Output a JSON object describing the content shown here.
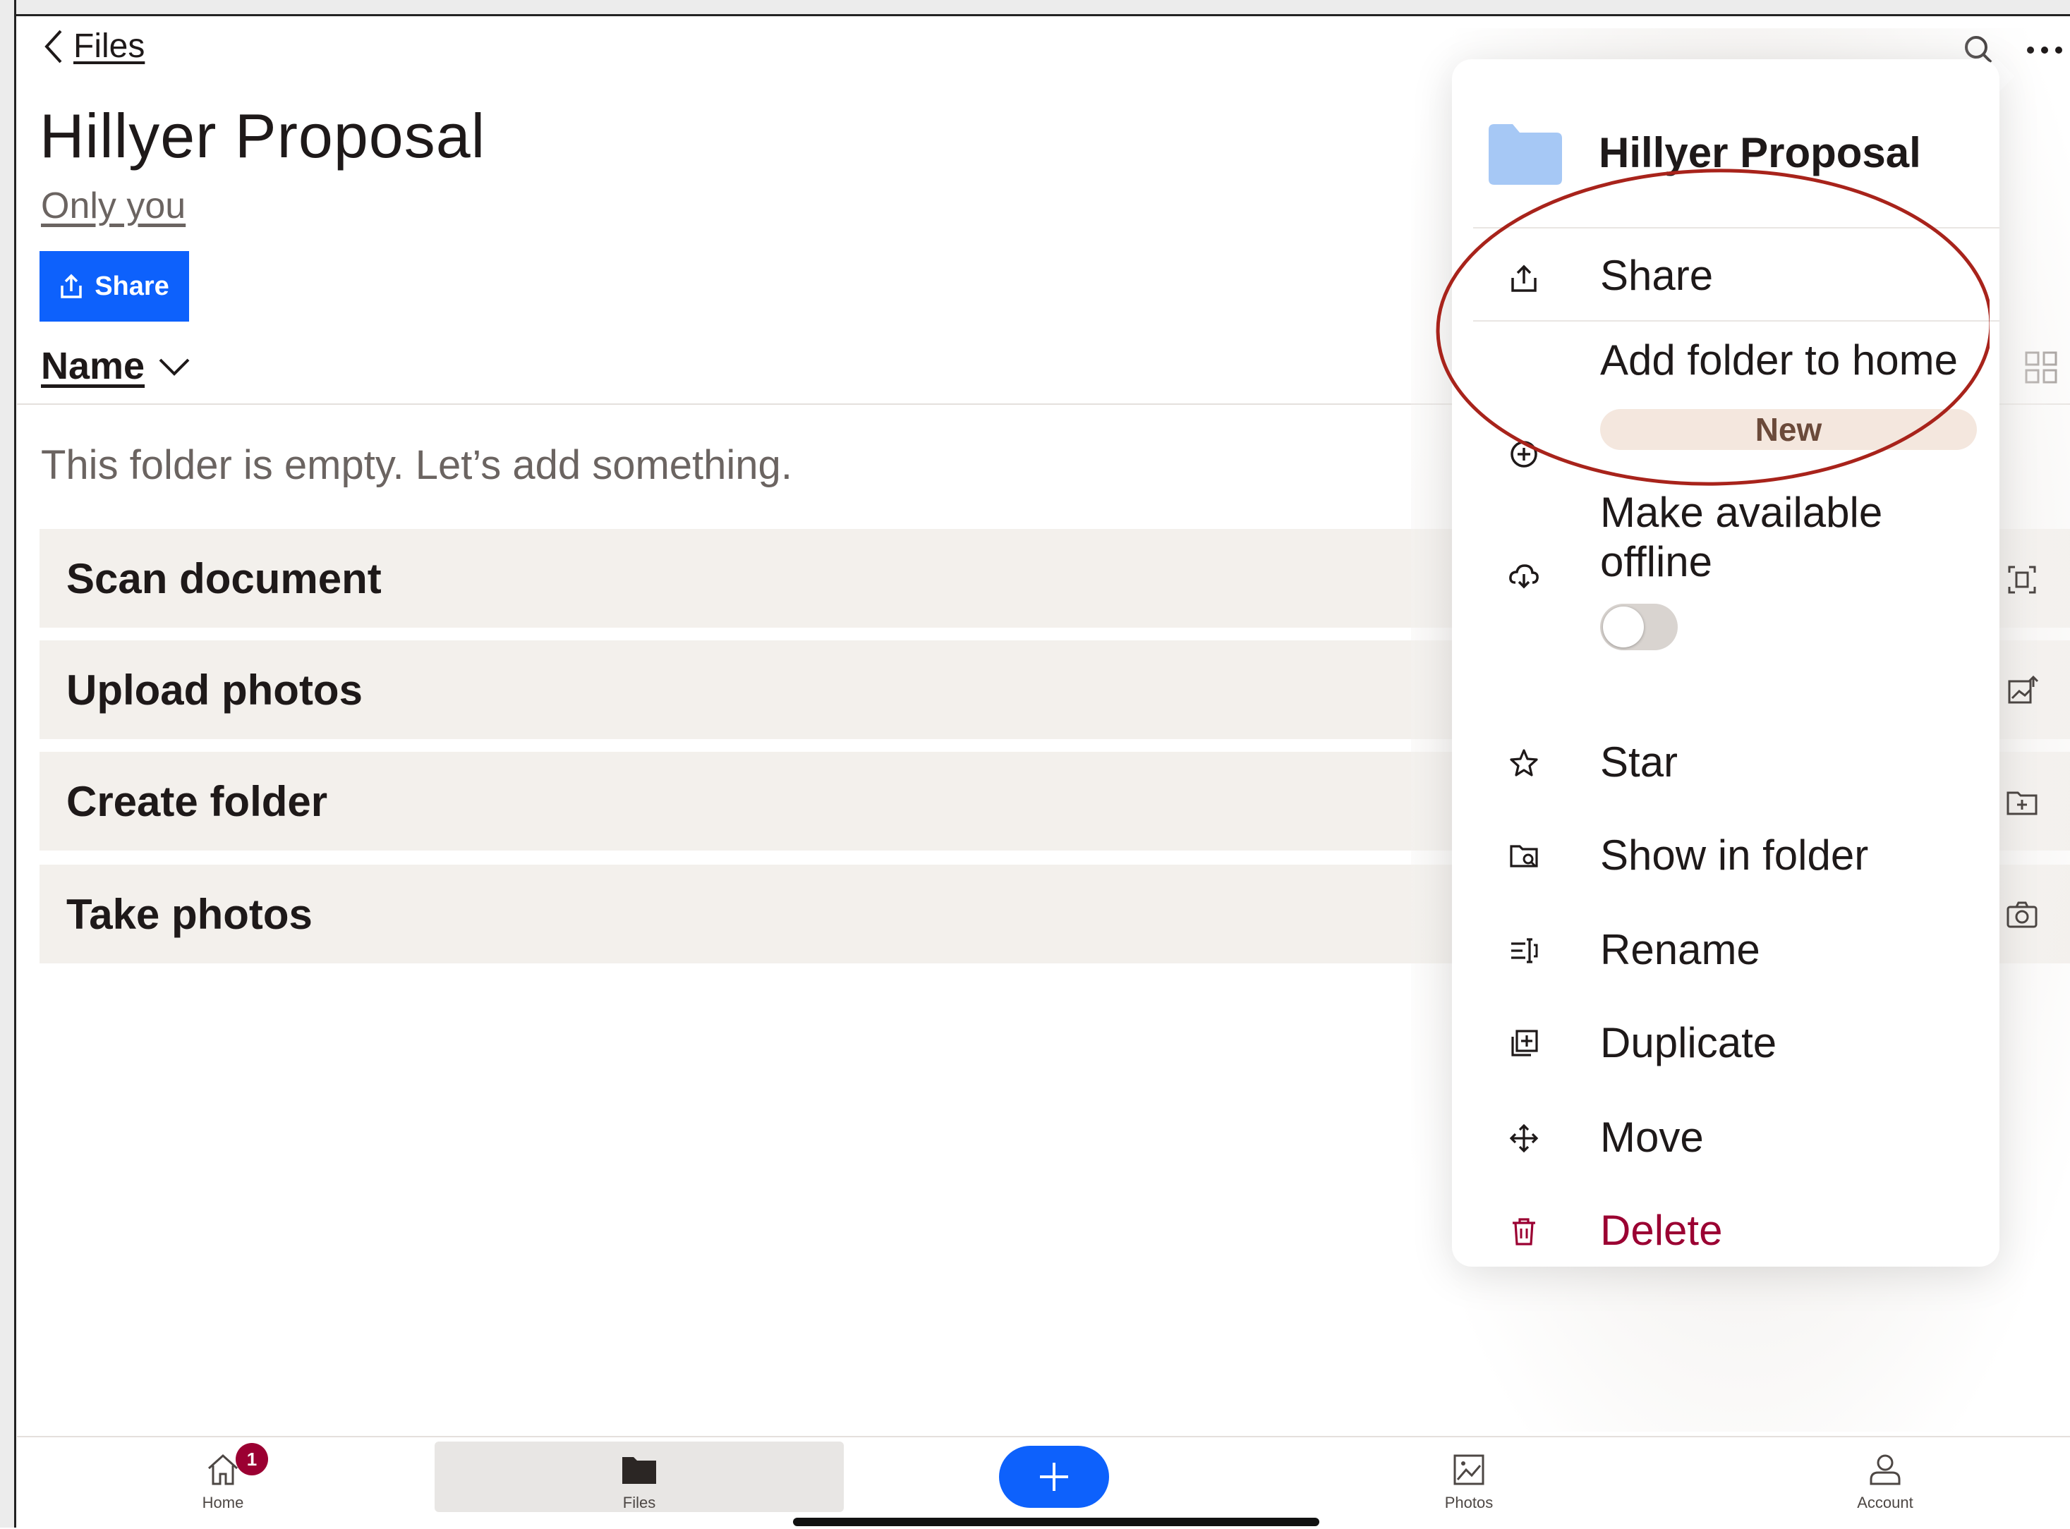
{
  "header": {
    "back_label": "Files",
    "title": "Hillyer Proposal",
    "sharing_status": "Only you",
    "share_button": "Share",
    "sort_label": "Name"
  },
  "main": {
    "empty_message": "This folder is empty. Let’s add something.",
    "actions": [
      {
        "label": "Scan document",
        "icon": "scan-icon"
      },
      {
        "label": "Upload photos",
        "icon": "upload-photo-icon"
      },
      {
        "label": "Create folder",
        "icon": "create-folder-icon"
      },
      {
        "label": "Take photos",
        "icon": "camera-icon"
      }
    ]
  },
  "popover": {
    "title": "Hillyer Proposal",
    "folder_icon": "folder-icon",
    "items": [
      {
        "label": "Share",
        "icon": "share-icon"
      },
      {
        "label": "Add folder to home",
        "icon": "add-circle-icon",
        "badge": "New"
      },
      {
        "label": "Make available offline",
        "line1": "Make available",
        "line2": "offline",
        "icon": "cloud-download-icon",
        "toggle_on": false
      },
      {
        "label": "Star",
        "icon": "star-icon"
      },
      {
        "label": "Show in folder",
        "icon": "folder-search-icon"
      },
      {
        "label": "Rename",
        "icon": "rename-icon"
      },
      {
        "label": "Duplicate",
        "icon": "duplicate-icon"
      },
      {
        "label": "Move",
        "icon": "move-icon"
      },
      {
        "label": "Delete",
        "icon": "trash-icon"
      }
    ]
  },
  "nav": {
    "items": [
      {
        "label": "Home",
        "icon": "home-icon",
        "badge": "1"
      },
      {
        "label": "Files",
        "icon": "folder-icon",
        "active": true
      },
      {
        "label": "Photos",
        "icon": "photos-icon"
      },
      {
        "label": "Account",
        "icon": "account-icon"
      }
    ],
    "fab_icon": "plus-icon"
  },
  "colors": {
    "accent": "#0d61fc",
    "danger": "#9b0032",
    "annotation": "#a8231b",
    "row_bg": "#f3f0ec",
    "new_pill": "#f4e7de"
  }
}
